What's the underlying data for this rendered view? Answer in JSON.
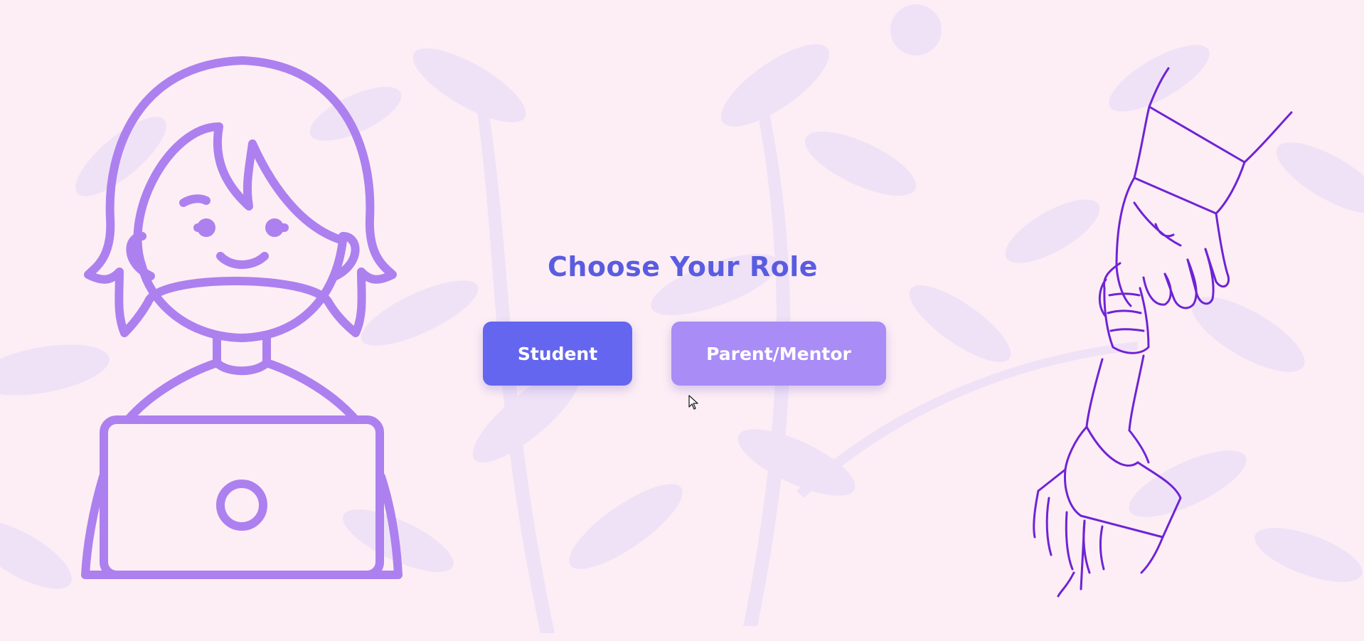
{
  "page": {
    "title": "Choose Your Role"
  },
  "buttons": {
    "student_label": "Student",
    "parent_label": "Parent/Mentor"
  },
  "illustrations": {
    "left": "student-with-laptop-illustration",
    "right": "holding-hands-illustration"
  },
  "colors": {
    "background": "#fdeef5",
    "title": "#5a5ce0",
    "student_button": "#6466ef",
    "parent_button": "#a98cf6",
    "student_illustration_stroke": "#ad80ef",
    "hands_illustration_stroke": "#6f23d6",
    "leaf_pattern": "#eddff6"
  }
}
